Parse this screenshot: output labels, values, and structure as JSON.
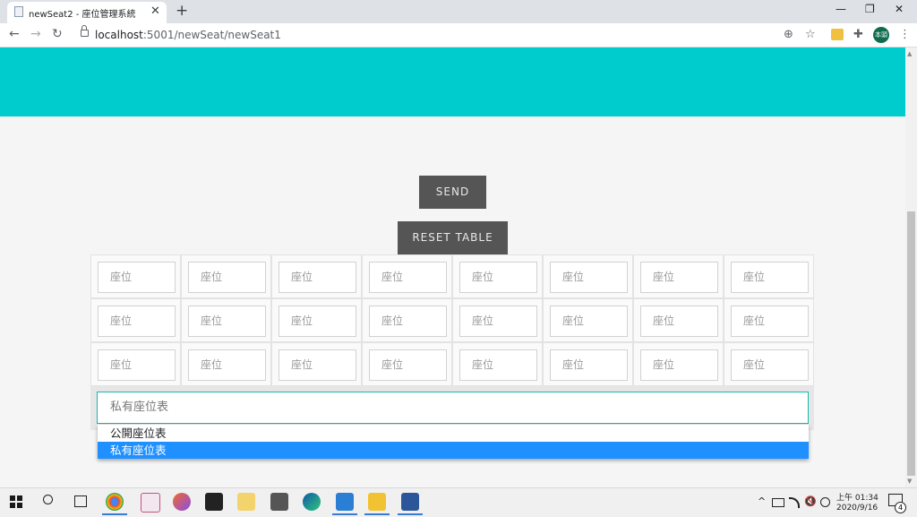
{
  "browser": {
    "tab_title": "newSeat2 - 座位管理系統",
    "close_glyph": "✕",
    "newtab_glyph": "+",
    "url_host": "localhost",
    "url_rest": ":5001/newSeat/newSeat1",
    "profile_text": "本頭",
    "win_min": "—",
    "win_restore": "❐",
    "win_close": "✕",
    "back": "←",
    "forward": "→",
    "reload": "↻",
    "zoom_glyph": "⊕",
    "star_glyph": "☆",
    "ext_glyph": "✚",
    "menu_glyph": "⋮"
  },
  "page": {
    "send_label": "SEND",
    "reset_label": "RESET TABLE",
    "seat_placeholder": "座位",
    "grid_rows": 3,
    "grid_cols": 8,
    "select_value": "私有座位表",
    "options": [
      "公開座位表",
      "私有座位表"
    ],
    "selected_option_index": 1,
    "banner_color": "#00ccce",
    "button_color": "#555555",
    "highlight_color": "#1e90ff"
  },
  "taskbar": {
    "clock_time": "上午 01:34",
    "clock_date": "2020/9/16",
    "notification_count": "4",
    "tray_chevron": "^",
    "volume_glyph": "🔇"
  }
}
